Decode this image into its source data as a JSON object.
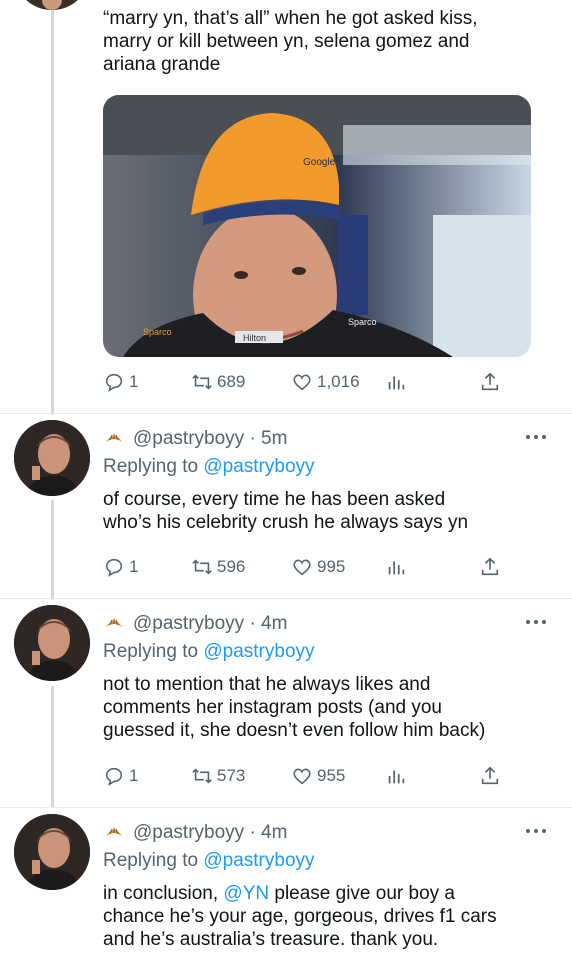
{
  "tweets": [
    {
      "text": "“marry yn, that’s all” when he got asked kiss,\nmarry or kill between yn, selena gomez and\nariana grande",
      "media": {
        "cap_logo": "Google",
        "shirt_text": "Hilton",
        "brand_left": "Sparco",
        "brand_right": "Sparco"
      },
      "stats": {
        "replies": "1",
        "retweets": "689",
        "likes": "1,016"
      }
    },
    {
      "handle": "@pastryboyy",
      "time": "· 5m",
      "replying_prefix": "Replying to",
      "replying_to": "@pastryboyy",
      "text": "of course, every time he has been asked\nwho’s his celebrity crush he always says yn",
      "stats": {
        "replies": "1",
        "retweets": "596",
        "likes": "995"
      }
    },
    {
      "handle": "@pastryboyy",
      "time": "· 4m",
      "replying_prefix": "Replying to",
      "replying_to": "@pastryboyy",
      "text": "not to mention that he always likes and\ncomments her instagram posts (and you\nguessed it, she doesn’t even follow him back)",
      "stats": {
        "replies": "1",
        "retweets": "573",
        "likes": "955"
      }
    },
    {
      "handle": "@pastryboyy",
      "time": "· 4m",
      "replying_prefix": "Replying to",
      "replying_to": "@pastryboyy",
      "text_before": "in conclusion, ",
      "mention": "@YN",
      "text_after": " please give our boy a\nchance he’s your age, gorgeous, drives f1 cars\nand he’s australia’s treasure. thank you."
    }
  ],
  "colors": {
    "link": "#1d9bf0",
    "muted": "#536471",
    "text": "#0f1419",
    "line": "#cfd9de"
  },
  "icons": [
    "reply-icon",
    "retweet-icon",
    "like-icon",
    "analytics-icon",
    "share-icon",
    "more-icon",
    "croissant-emoji"
  ]
}
